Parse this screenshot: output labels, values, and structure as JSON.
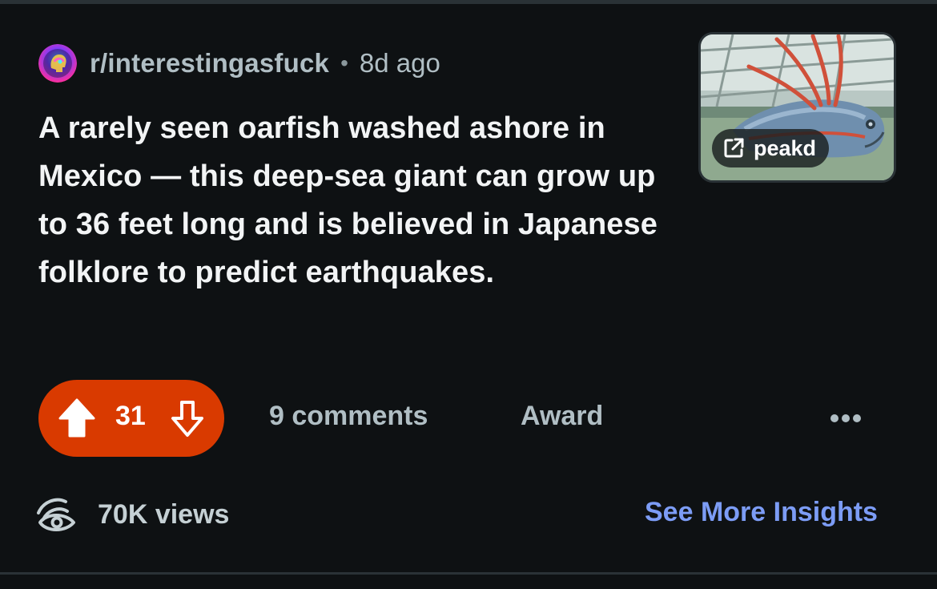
{
  "post": {
    "subreddit": "r/interestingasfuck",
    "separator": "•",
    "age": "8d ago",
    "title": "A rarely seen oarfish washed ashore in Mexico — this deep-sea giant can grow up to 36 feet long and is believed in Japanese folklore to predict earthquakes.",
    "thumbnail": {
      "link_domain": "peakd",
      "icon": "external-link-icon"
    }
  },
  "actions": {
    "upvote_icon": "arrow-up-icon",
    "vote_count": "31",
    "downvote_icon": "arrow-down-icon",
    "comments_label": "9 comments",
    "award_label": "Award",
    "more_icon": "more-dots-icon"
  },
  "insights": {
    "views_icon": "views-icon",
    "views_label": "70K views",
    "link_label": "See More Insights"
  },
  "colors": {
    "background": "#0e1113",
    "vote_active": "#d93a00",
    "link": "#7c9cf5",
    "muted_text": "#b0bec4"
  }
}
